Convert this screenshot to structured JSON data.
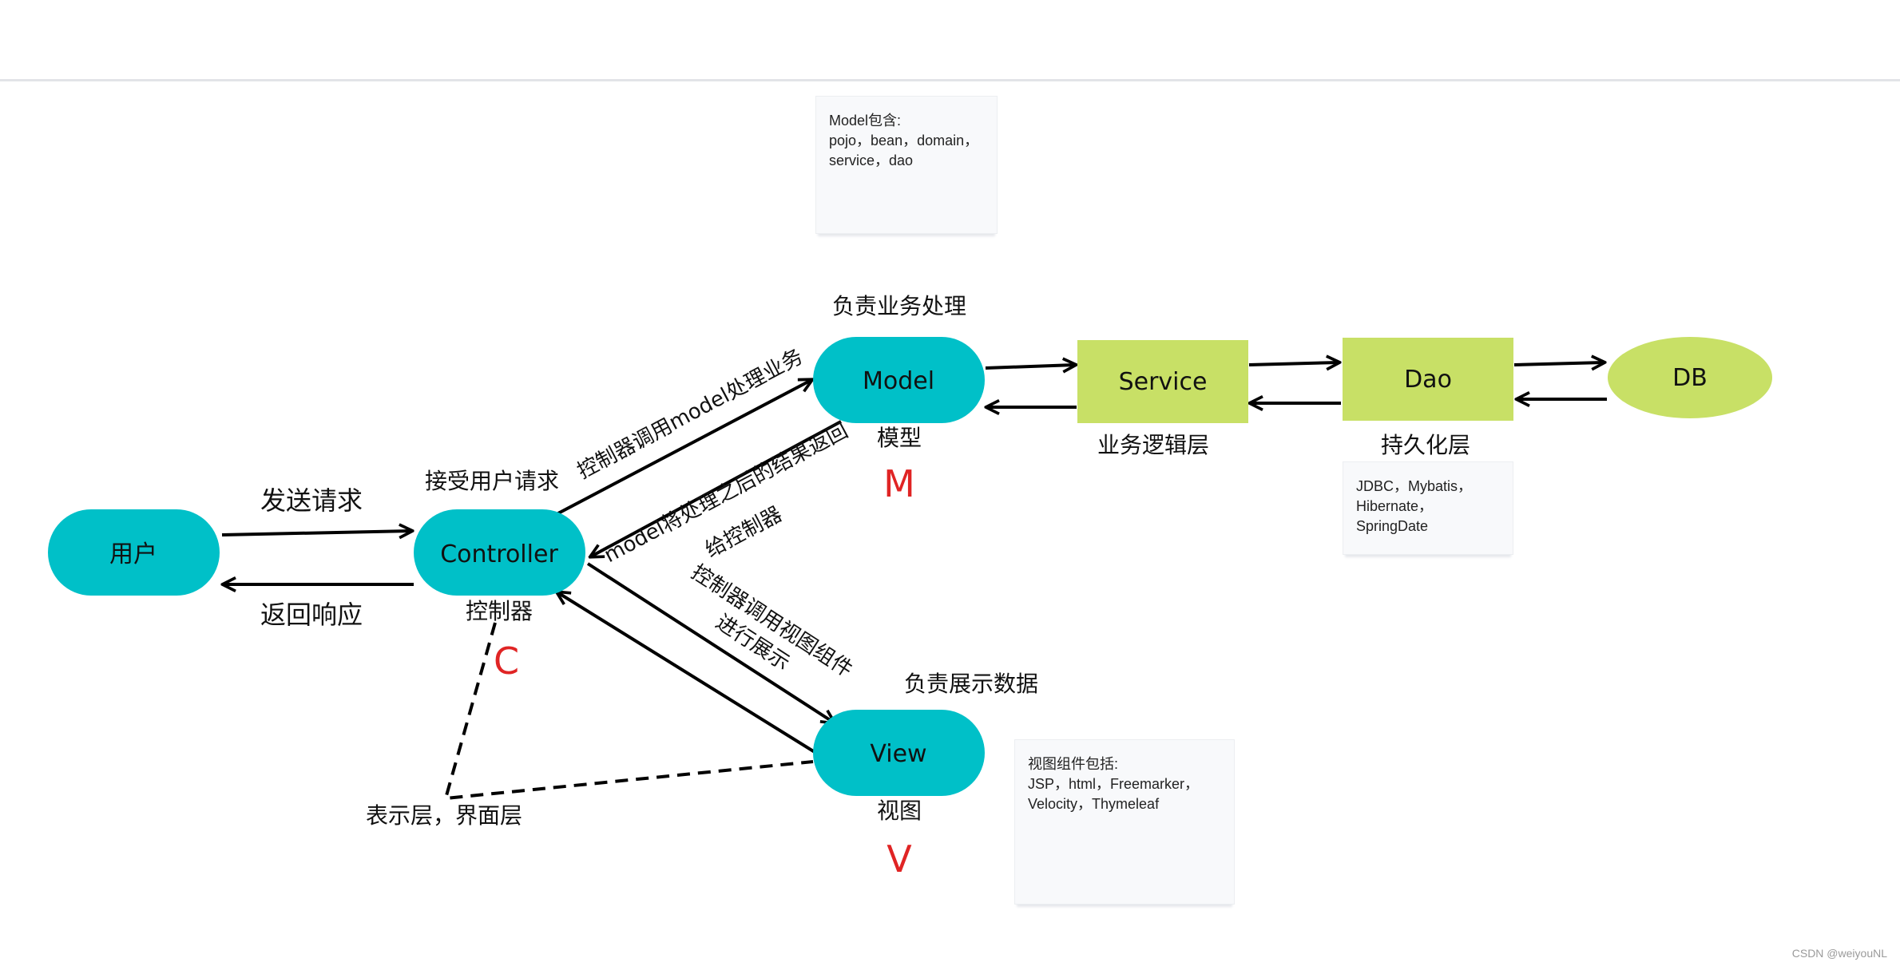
{
  "colors": {
    "primary_node": "#00c0c8",
    "secondary_node": "#c8e066",
    "mvc_letter": "#e02424",
    "line": "#000000",
    "note_bg": "#f8f9fb"
  },
  "nodes": {
    "user": "用户",
    "controller": "Controller",
    "model": "Model",
    "view": "View",
    "service": "Service",
    "dao": "Dao",
    "db": "DB"
  },
  "captions": {
    "controller_above": "接受用户请求",
    "controller_below": "控制器",
    "model_above": "负责业务处理",
    "model_below": "模型",
    "view_above": "负责展示数据",
    "view_below": "视图",
    "service_below": "业务逻辑层",
    "dao_below": "持久化层",
    "presentation_layer": "表示层，界面层"
  },
  "letters": {
    "c": "C",
    "m": "M",
    "v": "V"
  },
  "edges": {
    "send_request": "发送请求",
    "return_response": "返回响应",
    "controller_to_model": "控制器调用model处理业务",
    "model_to_controller_line1": "model将处理之后的结果返回",
    "model_to_controller_line2": "给控制器",
    "controller_to_view_line1": "控制器调用视图组件",
    "controller_to_view_line2": "进行展示"
  },
  "notes": {
    "model": "Model包含:\npojo，bean，domain，\nservice，dao",
    "dao": "JDBC，Mybatis，\nHibernate，\nSpringDate",
    "view": "视图组件包括:\nJSP，html，Freemarker，\nVelocity，Thymeleaf"
  },
  "watermark": "CSDN @weiyouNL"
}
